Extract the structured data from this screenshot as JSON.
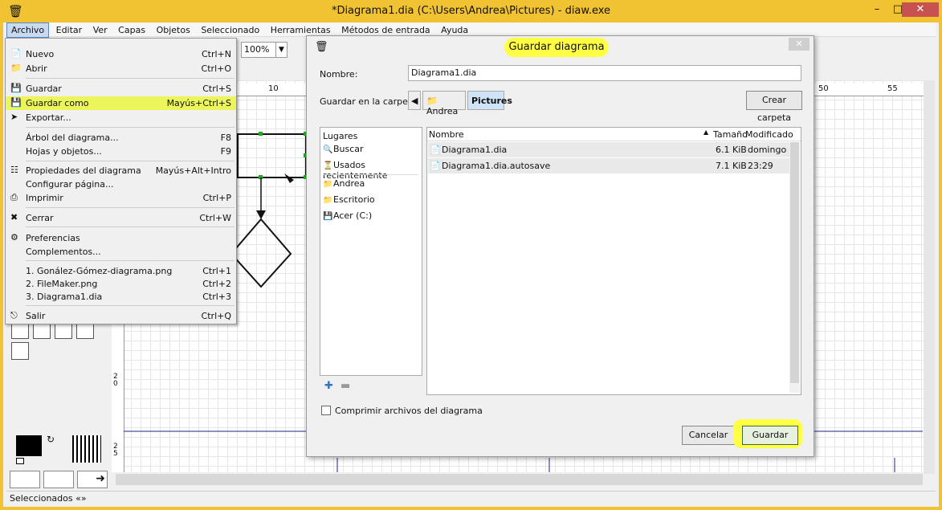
{
  "window": {
    "title": "*Diagrama1.dia (C:\\Users\\Andrea\\Pictures) - diaw.exe",
    "app_icon": "dia-app-icon"
  },
  "menubar": [
    "Archivo",
    "Editar",
    "Ver",
    "Capas",
    "Objetos",
    "Seleccionado",
    "Herramientas",
    "Métodos de entrada",
    "Ayuda"
  ],
  "toolbar": {
    "zoom": "100%"
  },
  "ruler": {
    "h_ticks": [
      "10",
      "50",
      "55"
    ],
    "v_ticks": [
      "2\n0",
      "2\n5"
    ]
  },
  "statusbar": {
    "text": "Seleccionados «»"
  },
  "archivo_menu": [
    {
      "label": "Nuevo",
      "shortcut": "Ctrl+N",
      "icon": "new-file-icon"
    },
    {
      "label": "Abrir",
      "shortcut": "Ctrl+O",
      "icon": "open-folder-icon"
    },
    {
      "label": "Guardar",
      "shortcut": "Ctrl+S",
      "icon": "save-icon"
    },
    {
      "label": "Guardar como",
      "shortcut": "Mayús+Ctrl+S",
      "icon": "save-as-icon"
    },
    {
      "label": "Exportar...",
      "shortcut": "",
      "icon": "export-icon"
    },
    {
      "label": "Árbol del diagrama...",
      "shortcut": "F8",
      "icon": ""
    },
    {
      "label": "Hojas y objetos...",
      "shortcut": "F9",
      "icon": ""
    },
    {
      "label": "Propiedades del diagrama",
      "shortcut": "Mayús+Alt+Intro",
      "icon": "properties-icon"
    },
    {
      "label": "Configurar página...",
      "shortcut": "",
      "icon": ""
    },
    {
      "label": "Imprimir",
      "shortcut": "Ctrl+P",
      "icon": "print-icon"
    },
    {
      "label": "Cerrar",
      "shortcut": "Ctrl+W",
      "icon": "close-x-icon"
    },
    {
      "label": "Preferencias",
      "shortcut": "",
      "icon": "preferences-icon"
    },
    {
      "label": "Complementos...",
      "shortcut": "",
      "icon": ""
    },
    {
      "label": "1. Gonález-Gómez-diagrama.png",
      "shortcut": "Ctrl+1",
      "icon": ""
    },
    {
      "label": "2. FileMaker.png",
      "shortcut": "Ctrl+2",
      "icon": ""
    },
    {
      "label": "3. Diagrama1.dia",
      "shortcut": "Ctrl+3",
      "icon": ""
    },
    {
      "label": "Salir",
      "shortcut": "Ctrl+Q",
      "icon": "quit-icon"
    }
  ],
  "dialog": {
    "title": "Guardar diagrama",
    "name_label": "Nombre:",
    "name_value": "Diagrama1.dia",
    "folder_label": "Guardar en la carpeta:",
    "breadcrumbs": [
      "Andrea",
      "Pictures"
    ],
    "create_folder": "Crear carpeta",
    "places_header": "Lugares",
    "places": [
      {
        "label": "Buscar",
        "icon": "search-icon"
      },
      {
        "label": "Usados recientemente",
        "icon": "recent-icon"
      },
      {
        "label": "Andrea",
        "icon": "folder-icon"
      },
      {
        "label": "Escritorio",
        "icon": "folder-icon"
      },
      {
        "label": "Acer (C:)",
        "icon": "drive-icon"
      }
    ],
    "columns": {
      "name": "Nombre",
      "size": "Tamaño",
      "modified": "Modificado"
    },
    "files": [
      {
        "name": "Diagrama1.dia",
        "size": "6.1 KiB",
        "modified": "domingo"
      },
      {
        "name": "Diagrama1.dia.autosave",
        "size": "7.1 KiB",
        "modified": "23:29"
      }
    ],
    "compress_label": "Comprimir archivos del diagrama",
    "cancel": "Cancelar",
    "save": "Guardar"
  }
}
